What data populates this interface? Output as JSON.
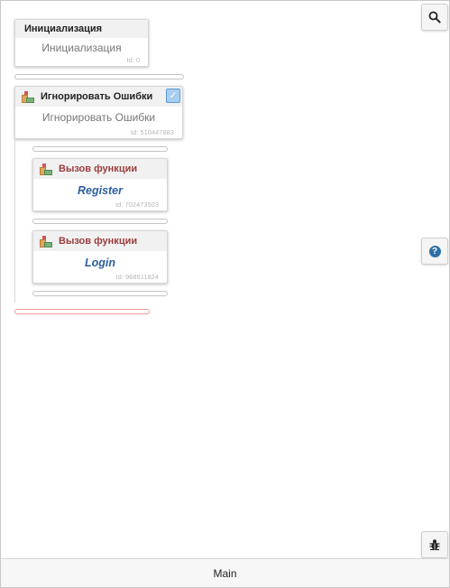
{
  "blocks": {
    "init": {
      "title": "Инициализация",
      "body": "Инициализация",
      "id": "Id: 0"
    },
    "ignore": {
      "title": "Игнорировать Ошибки",
      "body": "Игнорировать Ошибки",
      "id": "Id: 510447883",
      "checked": true
    },
    "call1": {
      "title": "Вызов функции",
      "body": "Register",
      "id": "Id: 702473503"
    },
    "call2": {
      "title": "Вызов функции",
      "body": "Login",
      "id": "Id: 968911824"
    }
  },
  "tools": {
    "search_icon": "search-icon",
    "help_icon": "help-icon",
    "help_glyph": "?",
    "debug_icon": "bug-icon"
  },
  "footer": {
    "label": "Main"
  },
  "colors": {
    "function_title": "#9b3d3d",
    "function_body": "#2c5f9e",
    "check_bg": "#a9cdf0",
    "error_slot": "#ef9a9a"
  }
}
